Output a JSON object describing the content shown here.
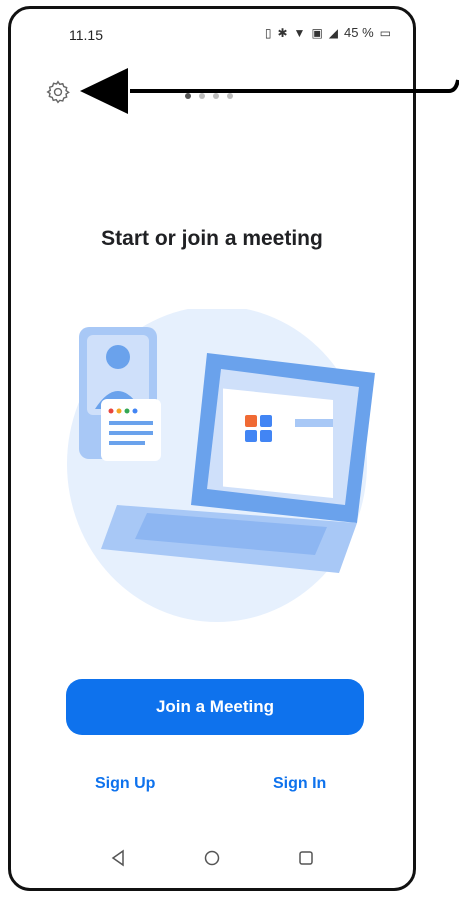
{
  "status_bar": {
    "time": "11.15",
    "battery": "45 %"
  },
  "onboarding": {
    "title": "Start or join a meeting",
    "page_dots": 4,
    "active_dot": 1
  },
  "actions": {
    "join_label": "Join a Meeting",
    "signup_label": "Sign Up",
    "signin_label": "Sign In"
  },
  "colors": {
    "accent": "#0e72ed",
    "illustration_light": "#e6f0fd",
    "illustration_mid": "#a8c8f6",
    "illustration_dark": "#6aa2ec"
  },
  "icons": {
    "settings": "gear-icon",
    "nav_back": "back-triangle-icon",
    "nav_home": "home-circle-icon",
    "nav_recent": "recent-square-icon"
  }
}
